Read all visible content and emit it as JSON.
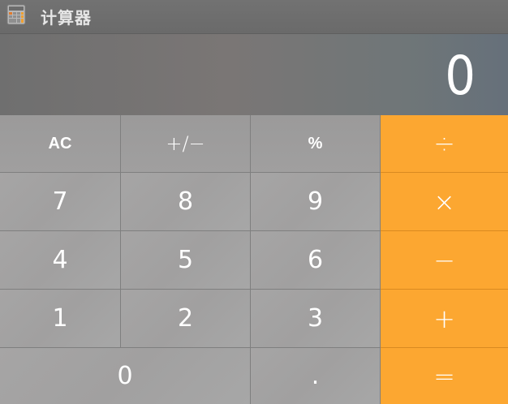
{
  "window": {
    "title": "计算器",
    "icon": "calculator-app-icon"
  },
  "display": {
    "value": "0"
  },
  "keys": {
    "clear": "AC",
    "sign": "+/−",
    "percent": "%",
    "divide": "÷",
    "seven": "7",
    "eight": "8",
    "nine": "9",
    "multiply": "×",
    "four": "4",
    "five": "5",
    "six": "6",
    "subtract": "−",
    "one": "1",
    "two": "2",
    "three": "3",
    "add": "+",
    "zero": "0",
    "decimal": ".",
    "equals": "="
  },
  "colors": {
    "operator": "#fca731",
    "function_key": "#9d9c9c",
    "number_key": "#a4a3a3",
    "key_text": "#ffffff"
  }
}
